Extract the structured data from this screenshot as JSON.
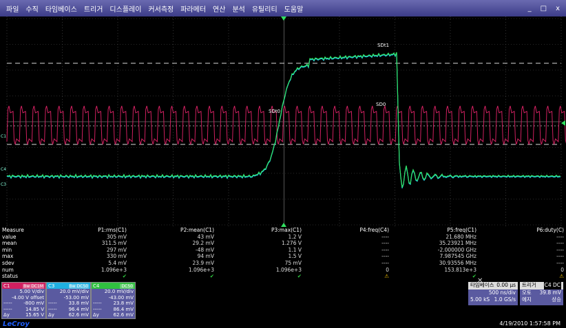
{
  "menu": [
    "파일",
    "수직",
    "타임베이스",
    "트리거",
    "디스플레이",
    "커서측정",
    "파라메터",
    "연산",
    "분석",
    "유틸리티",
    "도움말"
  ],
  "window_controls": [
    "_",
    "□",
    "x"
  ],
  "scope": {
    "markers": {
      "sdt1": "SDt1",
      "sdt0": "SDt0",
      "sd0": "SD0"
    },
    "left_labels": [
      "C4",
      "C1",
      "C3"
    ],
    "colors": {
      "C1": "#d02060",
      "C3": "#20d0ff",
      "C4": "#30e060",
      "grid": "#555555"
    }
  },
  "measure": {
    "header": [
      "Measure",
      "P1:rms(C1)",
      "P2:mean(C1)",
      "P3:max(C1)",
      "P4:freq(C4)",
      "P5:freq(C1)",
      "P6:duty(C)"
    ],
    "rows": [
      {
        "label": "value",
        "cells": [
          "305 mV",
          "43 mV",
          "1.2 V",
          "----",
          "21.680 MHz",
          "----"
        ]
      },
      {
        "label": "mean",
        "cells": [
          "311.5 mV",
          "29.2 mV",
          "1.276 V",
          "----",
          "35.23921 MHz",
          "----"
        ]
      },
      {
        "label": "min",
        "cells": [
          "297 mV",
          "-48 mV",
          "1.1 V",
          "----",
          "-2.000000 GHz",
          "----"
        ]
      },
      {
        "label": "max",
        "cells": [
          "330 mV",
          "94 mV",
          "1.5 V",
          "----",
          "7.987545 GHz",
          "----"
        ]
      },
      {
        "label": "sdev",
        "cells": [
          "5.4 mV",
          "23.9 mV",
          "75 mV",
          "----",
          "30.93556 MHz",
          "----"
        ]
      },
      {
        "label": "num",
        "cells": [
          "1.096e+3",
          "1.096e+3",
          "1.096e+3",
          "0",
          "153.813e+3",
          "0"
        ]
      },
      {
        "label": "status",
        "cells": [
          "✔",
          "✔",
          "✔",
          "⚠",
          "✔",
          "⚠"
        ]
      }
    ]
  },
  "channels": [
    {
      "id": "C1",
      "tags": [
        "Bw",
        "DC1M"
      ],
      "color": "#d02060",
      "rows": [
        [
          "",
          "5.00 V/div"
        ],
        [
          "",
          "-4.00 V offset"
        ],
        [
          "-----",
          "-800 mV"
        ],
        [
          "-----",
          "14.85 V"
        ],
        [
          "Δy",
          "15.65 V"
        ]
      ]
    },
    {
      "id": "C3",
      "tags": [
        "Bw",
        "DC50"
      ],
      "color": "#20b0e0",
      "rows": [
        [
          "",
          "20.0 mV/div"
        ],
        [
          "",
          "-53.00 mV"
        ],
        [
          "-----",
          "33.8 mV"
        ],
        [
          "-----",
          "96.4 mV"
        ],
        [
          "Δy",
          "62.6 mV"
        ]
      ]
    },
    {
      "id": "C4",
      "tags": [
        "",
        "DC50"
      ],
      "color": "#30c040",
      "rows": [
        [
          "",
          "20.0 mV/div"
        ],
        [
          "",
          "-43.00 mV"
        ],
        [
          "-----",
          "23.8 mV"
        ],
        [
          "-----",
          "86.4 mV"
        ],
        [
          "Δy",
          "62.6 mV"
        ]
      ]
    }
  ],
  "timebase": {
    "title": "타임베이스",
    "delay": "0.00 µs",
    "div": "500 ns/div",
    "samples": "5.00 kS",
    "rate": "1.0 GS/s"
  },
  "trigger": {
    "title": "트리거",
    "badge": "C4 DC",
    "mode": "오토",
    "level": "39.8 mV",
    "type": "에지",
    "slope": "상승"
  },
  "logo": "LeCroy",
  "timestamp": "4/19/2010 1:57:58 PM"
}
